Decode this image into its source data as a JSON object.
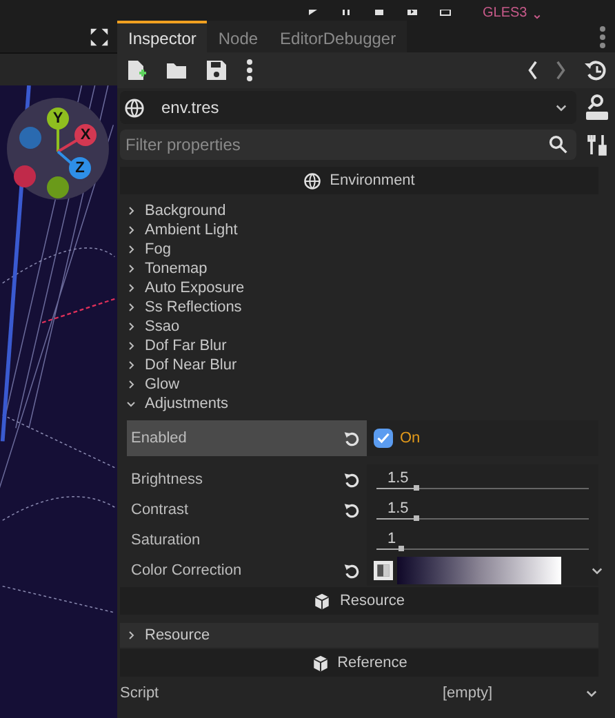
{
  "top_bar": {
    "renderer": "GLES3"
  },
  "viewport": {
    "gizmo_axes": [
      {
        "label": "Y",
        "color": "#8fbf1f"
      },
      {
        "label": "X",
        "color": "#d33852"
      },
      {
        "label": "Z",
        "color": "#2e8fe8"
      }
    ]
  },
  "tabs": [
    {
      "label": "Inspector",
      "selected": true
    },
    {
      "label": "Node",
      "selected": false
    },
    {
      "label": "EditorDebugger",
      "selected": false
    }
  ],
  "resource_picker": {
    "value": "env.tres"
  },
  "filter": {
    "placeholder": "Filter properties"
  },
  "sections": [
    {
      "title": "Environment",
      "groups": [
        {
          "label": "Background",
          "expanded": false
        },
        {
          "label": "Ambient Light",
          "expanded": false
        },
        {
          "label": "Fog",
          "expanded": false
        },
        {
          "label": "Tonemap",
          "expanded": false
        },
        {
          "label": "Auto Exposure",
          "expanded": false
        },
        {
          "label": "Ss Reflections",
          "expanded": false
        },
        {
          "label": "Ssao",
          "expanded": false
        },
        {
          "label": "Dof Far Blur",
          "expanded": false
        },
        {
          "label": "Dof Near Blur",
          "expanded": false
        },
        {
          "label": "Glow",
          "expanded": false
        },
        {
          "label": "Adjustments",
          "expanded": true,
          "properties": [
            {
              "kind": "checkbox",
              "label": "Enabled",
              "selected": true,
              "revertable": true,
              "checked": true,
              "value": "On"
            },
            {
              "kind": "slider",
              "label": "Brightness",
              "selected": false,
              "revertable": true,
              "value": "1.5",
              "level": 0.2
            },
            {
              "kind": "slider",
              "label": "Contrast",
              "selected": false,
              "revertable": true,
              "value": "1.5",
              "level": 0.2
            },
            {
              "kind": "slider",
              "label": "Saturation",
              "selected": false,
              "revertable": false,
              "value": "1",
              "level": 0.13
            },
            {
              "kind": "gradient",
              "label": "Color Correction",
              "selected": false,
              "revertable": true
            }
          ]
        }
      ]
    },
    {
      "title": "Resource",
      "groups": [
        {
          "label": "Resource",
          "expanded": false
        }
      ]
    },
    {
      "title": "Reference"
    }
  ],
  "script_row": {
    "label": "Script",
    "value": "[empty]"
  }
}
